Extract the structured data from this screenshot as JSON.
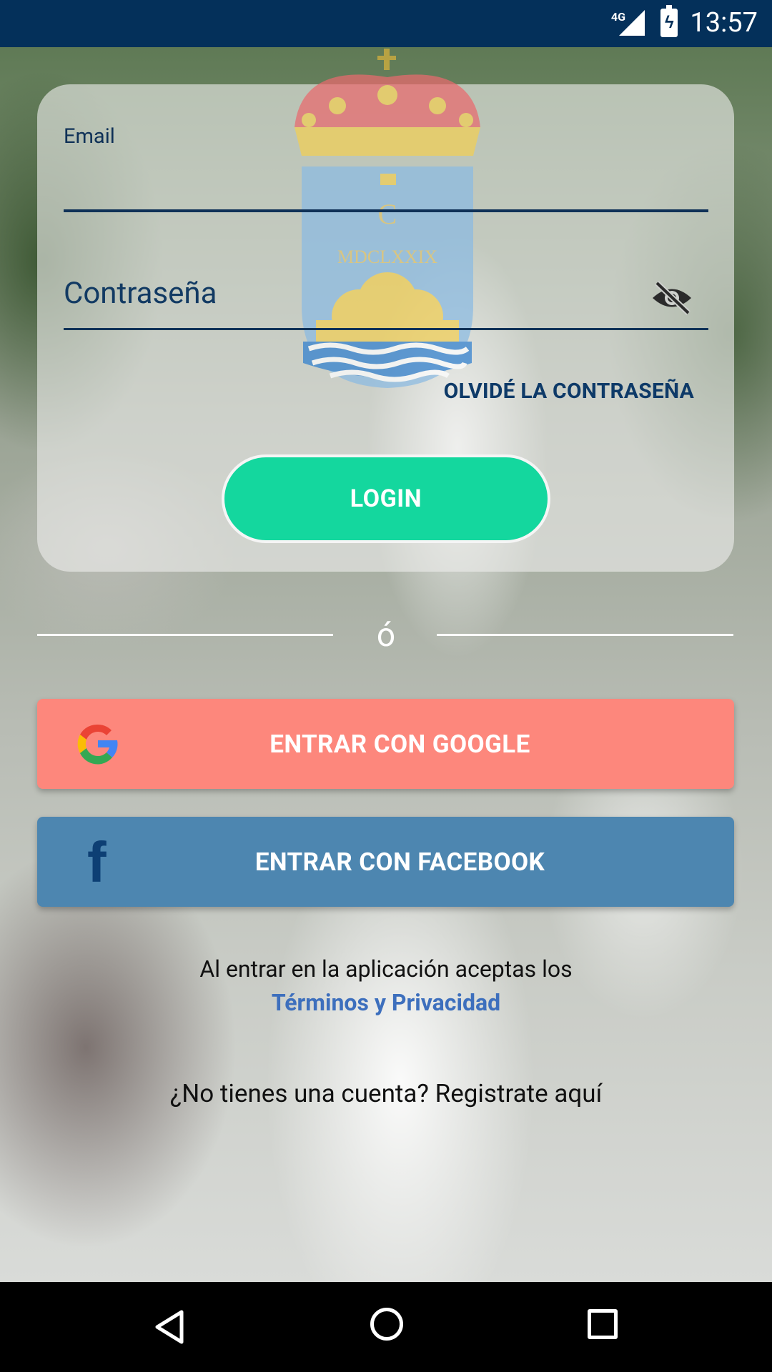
{
  "status_bar": {
    "network": "4G",
    "time": "13:57"
  },
  "login_form": {
    "email_label": "Email",
    "password_placeholder": "Contraseña",
    "forgot_password": "OLVIDÉ LA CONTRASEÑA",
    "login_button": "LOGIN",
    "crest_motto": "MDCLXXIX"
  },
  "divider": {
    "text": "ó"
  },
  "social": {
    "google_label": "ENTRAR CON GOOGLE",
    "facebook_label": "ENTRAR CON FACEBOOK"
  },
  "terms": {
    "text": "Al entrar en la aplicación aceptas los",
    "link": "Términos y Privacidad"
  },
  "register": {
    "text": "¿No tienes una cuenta? Registrate aquí"
  },
  "colors": {
    "status_bar": "#04305a",
    "login_button": "#14d79e",
    "google_button": "#fd877c",
    "facebook_button": "#4d86b0",
    "link": "#3d6fbd"
  },
  "icons": [
    "signal-icon",
    "battery-icon",
    "eye-off-icon",
    "google-icon",
    "facebook-icon",
    "back-icon",
    "home-icon",
    "recents-icon"
  ]
}
